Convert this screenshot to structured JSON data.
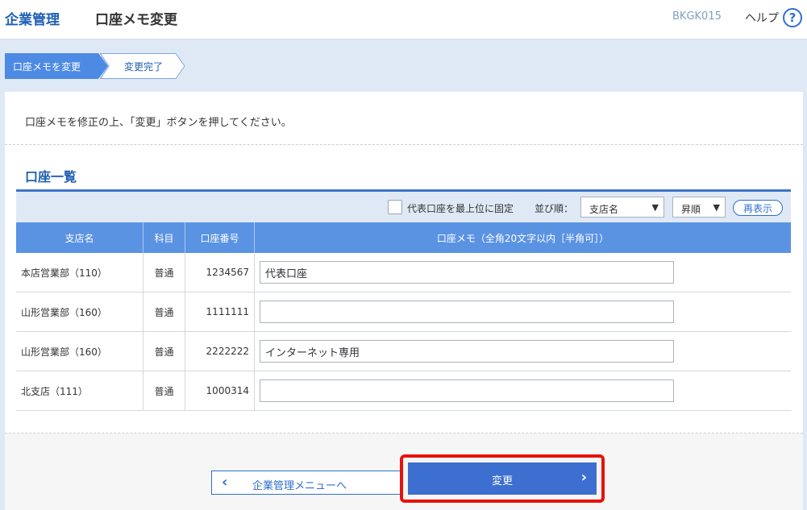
{
  "header": {
    "brand": "企業管理",
    "title": "口座メモ変更",
    "screen_id": "BKGK015",
    "help_label": "ヘルプ",
    "help_icon": "question-circle-icon"
  },
  "steps": [
    {
      "label": "口座メモを変更",
      "state": "current"
    },
    {
      "label": "変更完了",
      "state": "pending"
    }
  ],
  "instruction": "口座メモを修正の上、「変更」ボタンを押してください。",
  "section_title": "口座一覧",
  "toolbar": {
    "pin_checkbox_label": "代表口座を最上位に固定",
    "pin_checked": false,
    "sort_label": "並び順：",
    "sort_field": "支店名",
    "sort_order": "昇順",
    "refresh_label": "再表示"
  },
  "table": {
    "headers": [
      "支店名",
      "科目",
      "口座番号",
      "口座メモ（全角20文字以内［半角可］）"
    ],
    "rows": [
      {
        "branch": "本店営業部（110）",
        "subject": "普通",
        "account": "1234567",
        "memo": "代表口座"
      },
      {
        "branch": "山形営業部（160）",
        "subject": "普通",
        "account": "1111111",
        "memo": ""
      },
      {
        "branch": "山形営業部（160）",
        "subject": "普通",
        "account": "2222222",
        "memo": "インターネット専用"
      },
      {
        "branch": "北支店（111）",
        "subject": "普通",
        "account": "1000314",
        "memo": ""
      }
    ]
  },
  "buttons": {
    "back_label": "企業管理メニューへ",
    "change_label": "変更"
  },
  "colors": {
    "accent": "#1e5fb4",
    "header_row": "#5b93e3",
    "primary_button": "#3d6fd0",
    "highlight": "#e8110c"
  }
}
